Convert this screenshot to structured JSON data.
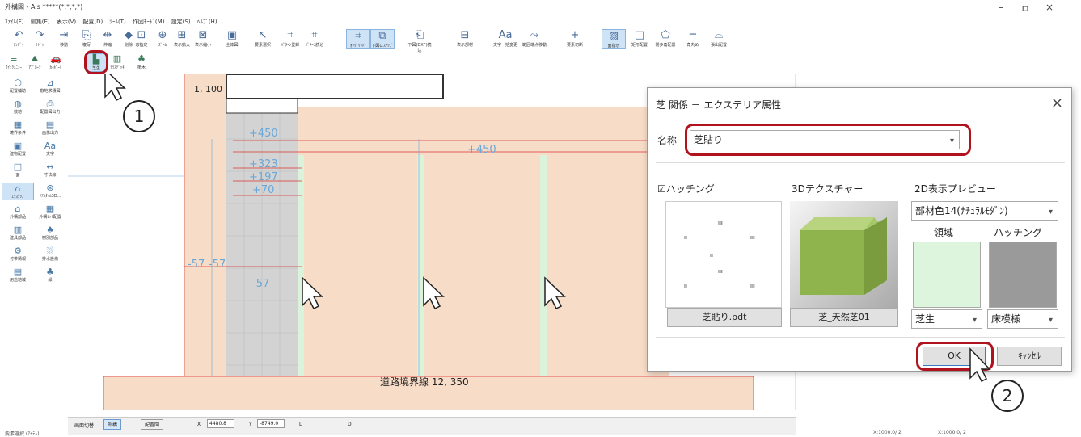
{
  "window": {
    "title": "外構図 - A's *****(*,*,*,*)",
    "minimize": "–",
    "maximize": "ㅁ",
    "close": "×"
  },
  "menu": [
    "ﾌｧｲﾙ(F)",
    "編集(E)",
    "表示(V)",
    "配置(D)",
    "ﾂｰﾙ(T)",
    "作図ﾓｰﾄﾞ(M)",
    "設定(S)",
    "ﾍﾙﾌﾟ(H)"
  ],
  "toolbar": [
    {
      "label": "ｱﾝﾄﾞｩ",
      "icon": "↶"
    },
    {
      "label": "ﾘﾄﾞｩ",
      "icon": "↷"
    },
    {
      "label": "移動",
      "icon": "⇥"
    },
    {
      "label": "複写",
      "icon": "⎘"
    },
    {
      "label": "伸縮",
      "icon": "⇹"
    },
    {
      "label": "削除",
      "icon": "◆"
    },
    {
      "label": "窓指定",
      "icon": "⊡"
    },
    {
      "label": "ｽﾞｰﾑ",
      "icon": "⊕"
    },
    {
      "label": "表示拡大",
      "icon": "⊞"
    },
    {
      "label": "表示縮小",
      "icon": "⊠"
    },
    {
      "label": "全体図",
      "icon": "▣"
    },
    {
      "label": "要素選択",
      "icon": "↖"
    },
    {
      "label": "ﾊﾟﾀｰﾝ登録",
      "icon": "⌗"
    },
    {
      "label": "ﾊﾟﾀｰﾝ読込",
      "icon": "⌗"
    },
    {
      "label": "ｵﾝｸﾞﾘｯﾄﾞ",
      "icon": "⌗"
    },
    {
      "label": "下図にｽﾅｯﾌﾟ",
      "icon": "⧉"
    },
    {
      "label": "下図(DXF)読込",
      "icon": "⎗"
    },
    {
      "label": "表示部材",
      "icon": "⊟"
    },
    {
      "label": "文字一括変更",
      "icon": "Aa"
    },
    {
      "label": "範囲端点移動",
      "icon": "⤳"
    },
    {
      "label": "要素切断",
      "icon": "+"
    },
    {
      "label": "面指示",
      "icon": "▨"
    },
    {
      "label": "矩形配置",
      "icon": "□"
    },
    {
      "label": "閉多角配置",
      "icon": "⬠"
    },
    {
      "label": "角丸め",
      "icon": "⌐"
    },
    {
      "label": "張出配置",
      "icon": "⌓"
    }
  ],
  "toolbar2": [
    {
      "label": "ｸｲｯｸﾒﾆｭｰ",
      "icon": "≡"
    },
    {
      "label": "ｱﾌﾟﾛｰﾁ",
      "icon": "⛰"
    },
    {
      "label": "ｶｰﾎﾟｰﾄ",
      "icon": "🚗"
    },
    {
      "label": "芝生",
      "icon": "▙"
    },
    {
      "label": "ﾃﾗｽﾃﾞｯｷ",
      "icon": "▥"
    },
    {
      "label": "植木",
      "icon": "♣"
    }
  ],
  "sidebar": [
    {
      "label": "配置補助",
      "icon": "⬡"
    },
    {
      "label": "敷地求積図",
      "icon": "⊿"
    },
    {
      "label": "敷地",
      "icon": "◍"
    },
    {
      "label": "配置図出力",
      "icon": "⎙"
    },
    {
      "label": "境界条件",
      "icon": "▦"
    },
    {
      "label": "画像出力",
      "icon": "▤"
    },
    {
      "label": "建物配置",
      "icon": "▣"
    },
    {
      "label": "文字",
      "icon": "Aa"
    },
    {
      "label": "面",
      "icon": "□"
    },
    {
      "label": "寸法線",
      "icon": "↔"
    },
    {
      "label": "ｴｸｽﾃﾘｱ",
      "icon": "⌂"
    },
    {
      "label": "ﾘｱﾙﾀｲﾑ3D...",
      "icon": "⊛"
    },
    {
      "label": "外構部品",
      "icon": "⌂"
    },
    {
      "label": "外構ｾｯﾄ配置",
      "icon": "▦"
    },
    {
      "label": "建具部品",
      "icon": "▥"
    },
    {
      "label": "樹別部品",
      "icon": "♠"
    },
    {
      "label": "付帯情報",
      "icon": "⚙"
    },
    {
      "label": "排水設備",
      "icon": "⛆"
    },
    {
      "label": "用途地域",
      "icon": "▤"
    },
    {
      "label": "緑",
      "icon": "♣"
    }
  ],
  "canvas": {
    "scale_label": "1, 100",
    "dims": [
      "+450",
      "+323",
      "+197",
      "+70",
      "+450",
      "-57",
      "-57",
      "-57"
    ],
    "road_label": "道路境界線  12, 350"
  },
  "status": {
    "switch_label": "画面切替",
    "tab_exterior": "外構",
    "tab_layout": "配置図",
    "x_label": "X",
    "x_value": "4480.8",
    "y_label": "Y",
    "y_value": "-8749.0",
    "l_label": "L",
    "d_label": "D",
    "zoom1": "X:1000.0/ 2",
    "zoom2": "X:1000.0/ 2"
  },
  "footer": {
    "text": "要素選択 (ｱｲﾃﾑ)"
  },
  "dialog": {
    "title": "芝 関係 － エクステリア属性",
    "close": "×",
    "name_label": "名称",
    "name_value": "芝貼り",
    "hatching_check": "☑ハッチング",
    "texture_label": "3Dテクスチャー",
    "preview_label": "2D表示プレビュー",
    "preview_select": "部材色14(ﾅﾁｭﾗﾙﾓﾀﾞﾝ)",
    "area_label": "領域",
    "hatch_label": "ハッチング",
    "hatch_file": "芝貼り.pdt",
    "texture_file": "芝_天然芝01",
    "area_select": "芝生",
    "hatch_select": "床模様",
    "ok": "OK",
    "cancel": "ｷｬﾝｾﾙ",
    "hatch_preview_marks": [
      "ııı",
      "ıı",
      "ııı",
      "ıı",
      "ııı",
      "ıı",
      "ııı",
      "ıı"
    ],
    "area_color": "#dcf5dc",
    "hatch_color": "#9a9a9a"
  },
  "callouts": {
    "one": "1",
    "two": "2"
  }
}
